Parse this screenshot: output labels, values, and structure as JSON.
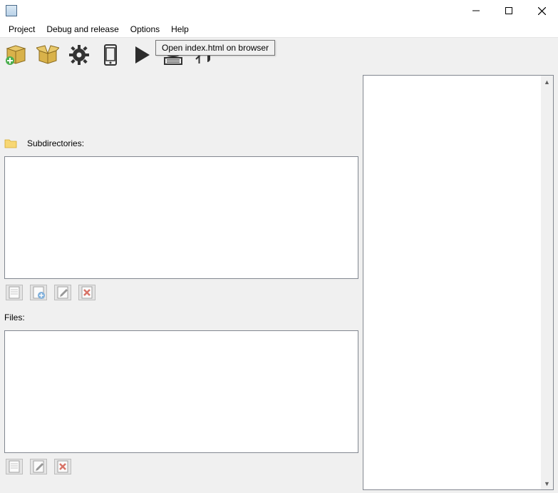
{
  "window": {
    "title": ""
  },
  "menu": {
    "items": [
      "Project",
      "Debug and release",
      "Options",
      "Help"
    ]
  },
  "toolbar": {
    "buttons": [
      {
        "name": "new-project",
        "icon": "box-plus-icon"
      },
      {
        "name": "open-project",
        "icon": "box-open-icon"
      },
      {
        "name": "settings",
        "icon": "gear-icon"
      },
      {
        "name": "device",
        "icon": "phone-icon"
      },
      {
        "name": "run",
        "icon": "play-icon"
      },
      {
        "name": "open-browser",
        "icon": "eye-web-icon"
      },
      {
        "name": "tools",
        "icon": "wrench-hammer-icon"
      }
    ],
    "tooltip": "Open index.html on browser"
  },
  "left": {
    "subdirs_label": "Subdirectories:",
    "files_label": "Files:",
    "subdir_buttons": [
      {
        "name": "subdir-new",
        "icon": "page-icon"
      },
      {
        "name": "subdir-add",
        "icon": "page-plus-icon"
      },
      {
        "name": "subdir-edit",
        "icon": "page-edit-icon"
      },
      {
        "name": "subdir-delete",
        "icon": "page-delete-icon"
      }
    ],
    "file_buttons": [
      {
        "name": "file-new",
        "icon": "page-icon"
      },
      {
        "name": "file-edit",
        "icon": "page-edit-icon"
      },
      {
        "name": "file-delete",
        "icon": "page-delete-icon"
      }
    ]
  }
}
